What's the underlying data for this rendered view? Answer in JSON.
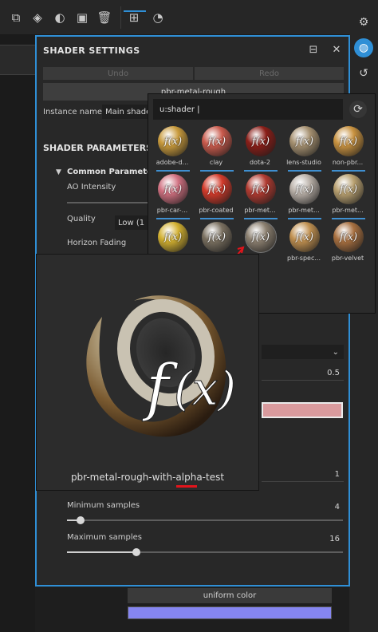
{
  "window": {
    "title": "SHADER SETTINGS",
    "undo": "Undo",
    "redo": "Redo",
    "shader_name": "pbr-metal-rough",
    "instance_label": "Instance name",
    "instance_value": "Main shader",
    "params_title": "SHADER PARAMETERS",
    "common_params": "Common Paramete",
    "ao_intensity": "AO Intensity",
    "quality_label": "Quality",
    "quality_value": "Low (1 6",
    "horizon_fading": "Horizon Fading",
    "value_05": "0.5",
    "value_1": "1",
    "min_samples_label": "Minimum samples",
    "min_samples_value": "4",
    "max_samples_label": "Maximum samples",
    "max_samples_value": "16",
    "min_samples_fraction": 0.05,
    "max_samples_fraction": 0.25,
    "tint_color": "#d99a9d"
  },
  "uniform": {
    "label": "uniform color",
    "color": "#8686f2"
  },
  "browser": {
    "search_value": "u:shader |",
    "items": [
      {
        "label": "adobe-d...",
        "color": "#c89a3c"
      },
      {
        "label": "clay",
        "color": "#c95a4c"
      },
      {
        "label": "dota-2",
        "color": "#8a1e18"
      },
      {
        "label": "lens-studio",
        "color": "#a59070"
      },
      {
        "label": "non-pbr...",
        "color": "#c89240"
      },
      {
        "label": "pbr-car-...",
        "color": "#d07080"
      },
      {
        "label": "pbr-coated",
        "color": "#d23a2a"
      },
      {
        "label": "pbr-met...",
        "color": "#b03a30"
      },
      {
        "label": "pbr-met...",
        "color": "#b9b0a8"
      },
      {
        "label": "pbr-met...",
        "color": "#b8a070"
      },
      {
        "label": "",
        "color": "#d2b030"
      },
      {
        "label": "",
        "color": "#7a7060"
      },
      {
        "label": "",
        "color": "#8c8070"
      },
      {
        "label": "pbr-spec...",
        "color": "#c09050"
      },
      {
        "label": "pbr-velvet",
        "color": "#a87040"
      }
    ]
  },
  "preview": {
    "label": "pbr-metal-rough-with-alpha-test",
    "fx": "f(x)"
  },
  "colors": {
    "accent": "#2f8fd6",
    "red_annotation": "#e3141b"
  }
}
